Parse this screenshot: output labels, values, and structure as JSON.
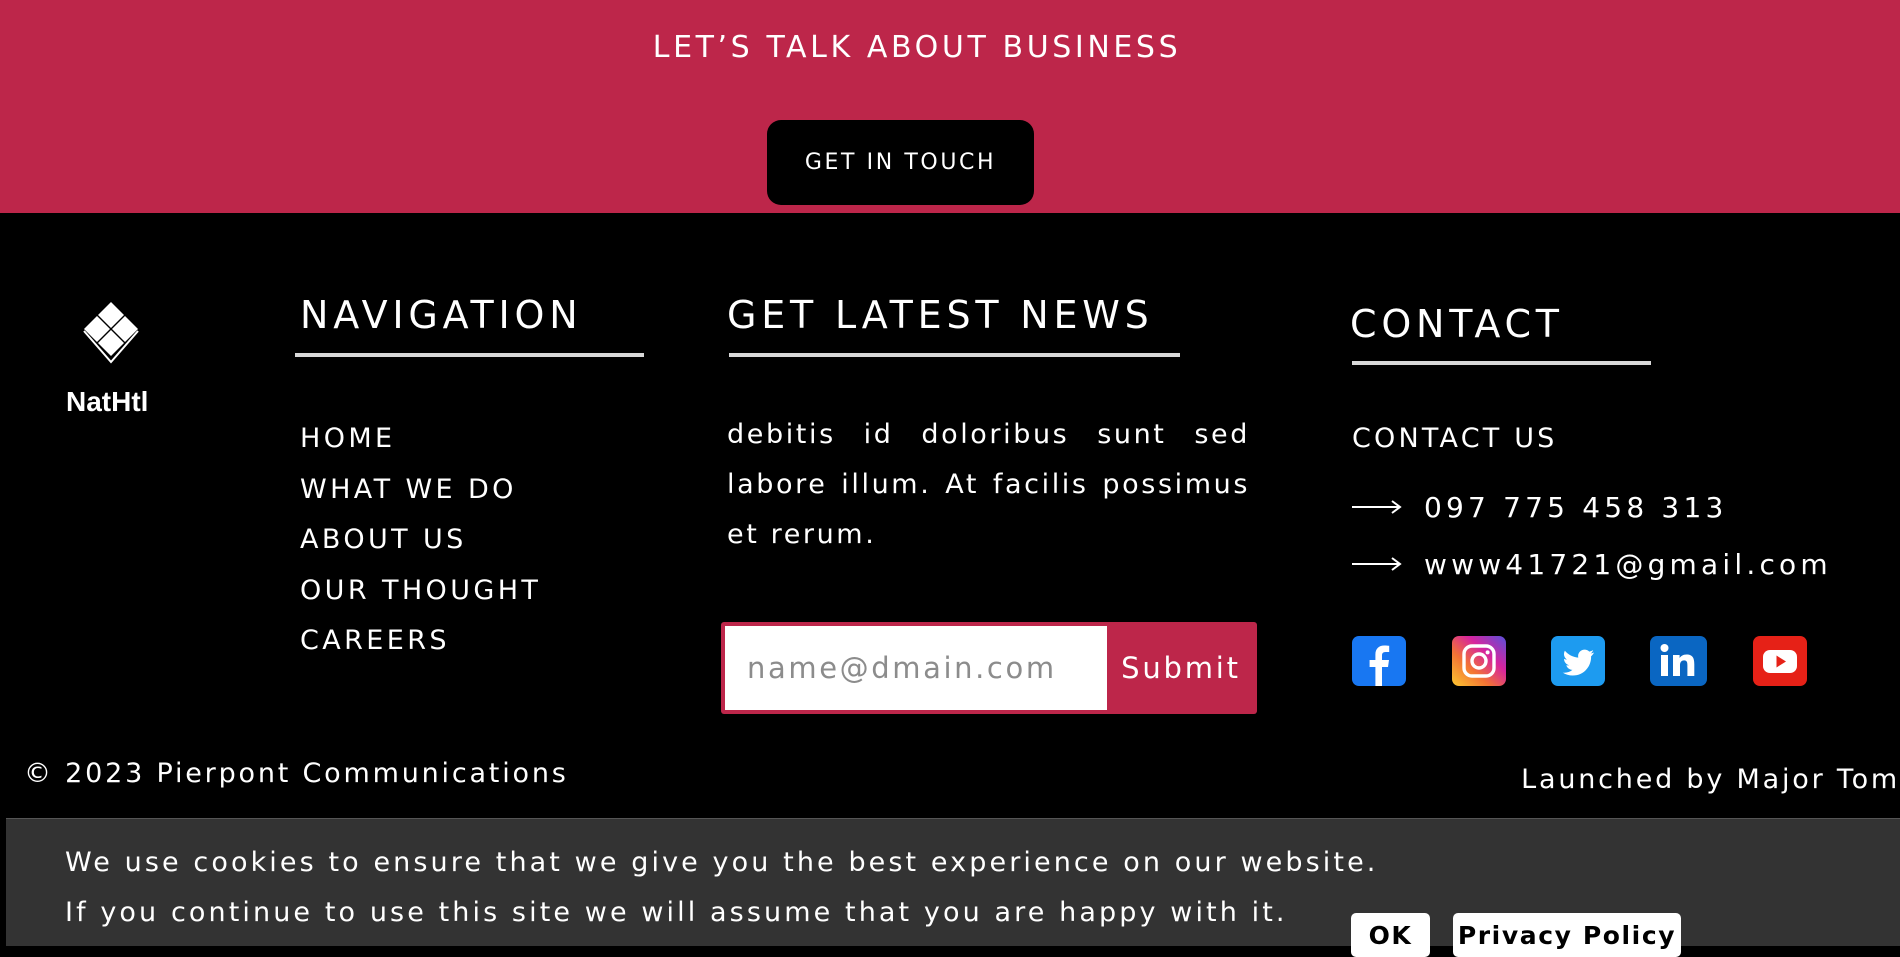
{
  "cta": {
    "title": "LET’S TALK ABOUT BUSINESS",
    "button_label": "GET IN TOUCH",
    "background_color": "#bd264a"
  },
  "brand": {
    "name": "NatHtl",
    "logo_icon": "diamond-grid-icon"
  },
  "navigation": {
    "heading": "NAVIGATION",
    "items": [
      {
        "label": "HOME"
      },
      {
        "label": "WHAT WE DO"
      },
      {
        "label": "ABOUT US"
      },
      {
        "label": "OUR THOUGHT"
      },
      {
        "label": "CAREERS"
      }
    ]
  },
  "news": {
    "heading": "GET LATEST NEWS",
    "text": "debitis id doloribus sunt sed labore illum. At facilis possimus et rerum.",
    "input_placeholder": "name@dmain.com",
    "input_value": "",
    "submit_label": "Submit"
  },
  "contact": {
    "heading": "CONTACT",
    "subheading": "CONTACT US",
    "phone": "097 775 458 313",
    "email": "www41721@gmail.com",
    "arrow_icon": "long-arrow-right-icon",
    "socials": [
      {
        "name": "facebook",
        "icon": "facebook-icon",
        "color": "#1877f2"
      },
      {
        "name": "instagram",
        "icon": "instagram-icon",
        "color": "#d6249f"
      },
      {
        "name": "twitter",
        "icon": "twitter-icon",
        "color": "#1d9bf0"
      },
      {
        "name": "linkedin",
        "icon": "linkedin-icon",
        "color": "#0a66c2"
      },
      {
        "name": "youtube",
        "icon": "youtube-icon",
        "color": "#e62117"
      }
    ]
  },
  "footer": {
    "copyright": "© 2023 Pierpont Communications",
    "launched_by": "Launched by Major Tom"
  },
  "cookie_banner": {
    "line1": "We use cookies to ensure that we give you the best experience on our website.",
    "line2": "If you continue to use this site we will assume that you are happy with it.",
    "ok_label": "OK",
    "privacy_label": "Privacy Policy"
  }
}
